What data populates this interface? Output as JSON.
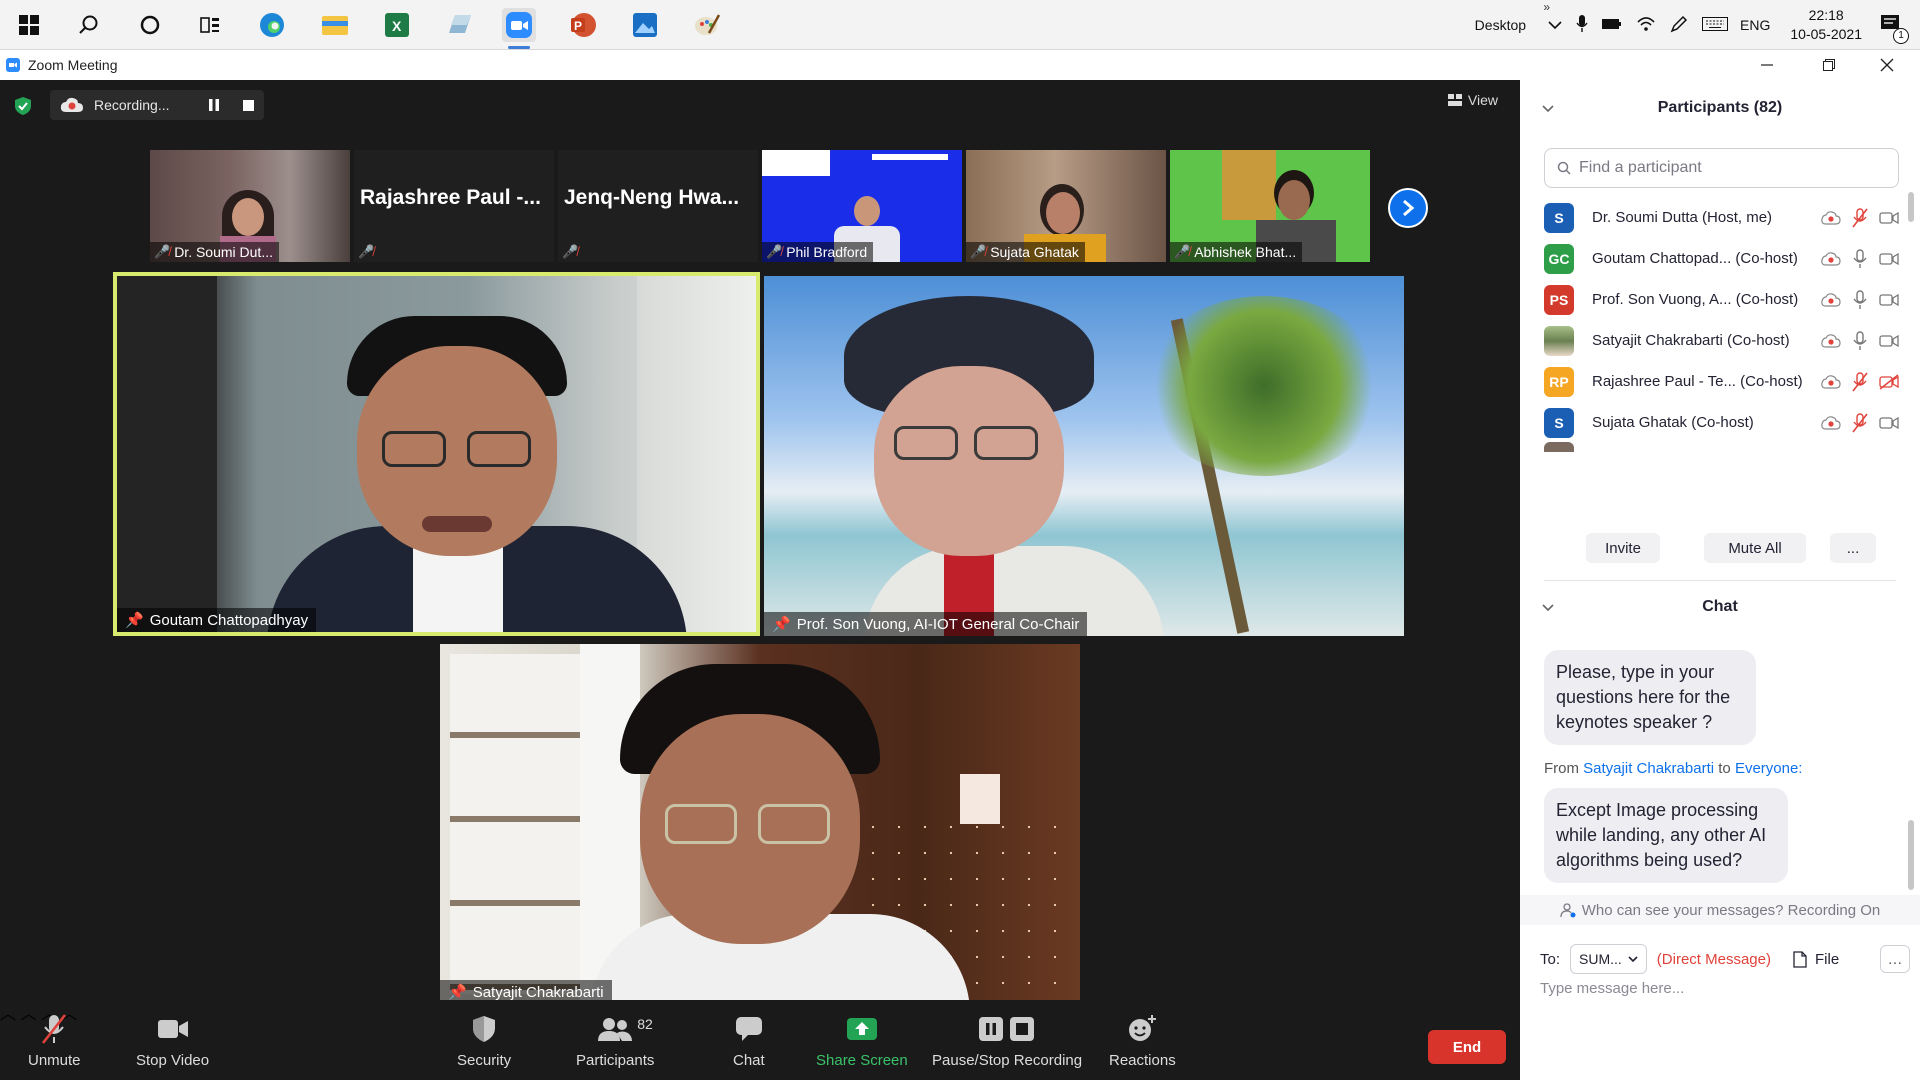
{
  "taskbar": {
    "tray_label": "Desktop",
    "lang": "ENG",
    "time": "22:18",
    "date": "10-05-2021",
    "notif_count": "1",
    "icons": [
      "windows-start-icon",
      "search-icon",
      "cortana-icon",
      "task-view-icon",
      "edge-icon",
      "file-explorer-icon",
      "excel-icon",
      "app-icon",
      "zoom-icon",
      "powerpoint-icon",
      "photos-icon",
      "paint-icon"
    ]
  },
  "window": {
    "title": "Zoom Meeting"
  },
  "meeting": {
    "recording_label": "Recording...",
    "view_label": "View",
    "thumbnails": [
      {
        "name": "Dr. Soumi Dut...",
        "type": "video"
      },
      {
        "name": "Rajashree Paul -...",
        "type": "name"
      },
      {
        "name": "Jenq-Neng Hwa...",
        "type": "name"
      },
      {
        "name": "Phil Bradford",
        "type": "video"
      },
      {
        "name": "Sujata Ghatak",
        "type": "video"
      },
      {
        "name": "Abhishek Bhat...",
        "type": "video"
      }
    ],
    "videos": [
      {
        "name": "Goutam Chattopadhyay"
      },
      {
        "name": "Prof. Son Vuong, AI-IOT General Co-Chair"
      },
      {
        "name": "Satyajit Chakrabarti"
      }
    ]
  },
  "toolbar": {
    "unmute": "Unmute",
    "stop_video": "Stop Video",
    "security": "Security",
    "participants": "Participants",
    "participants_count": "82",
    "chat": "Chat",
    "share_screen": "Share Screen",
    "pause_stop_recording": "Pause/Stop Recording",
    "reactions": "Reactions",
    "end": "End"
  },
  "participants_panel": {
    "title": "Participants (82)",
    "search_placeholder": "Find a participant",
    "list": [
      {
        "initials": "S",
        "color": "#1a5fb4",
        "name": "Dr. Soumi Dutta (Host, me)",
        "mic": "muted",
        "video": "on"
      },
      {
        "initials": "GC",
        "color": "#2e9e48",
        "name": "Goutam Chattopad...  (Co-host)",
        "mic": "on",
        "video": "on"
      },
      {
        "initials": "PS",
        "color": "#d33a2c",
        "name": "Prof. Son Vuong, A...  (Co-host)",
        "mic": "on",
        "video": "on"
      },
      {
        "initials": "",
        "color": "#7a8a5a",
        "name": "Satyajit Chakrabarti  (Co-host)",
        "mic": "on",
        "video": "on"
      },
      {
        "initials": "RP",
        "color": "#f5a623",
        "name": "Rajashree Paul - Te...  (Co-host)",
        "mic": "muted",
        "video": "off"
      },
      {
        "initials": "S",
        "color": "#1a5fb4",
        "name": "Sujata Ghatak  (Co-host)",
        "mic": "muted",
        "video": "on"
      }
    ],
    "invite": "Invite",
    "mute_all": "Mute All",
    "more": "..."
  },
  "chat_panel": {
    "title": "Chat",
    "msg1": "Please, type in your questions here for the keynotes speaker ?",
    "from_prefix": "From",
    "from_name": "Satyajit Chakrabarti",
    "to_word": "to",
    "to_name": "Everyone:",
    "msg2": "Except Image processing while landing, any other AI algorithms being used?",
    "privacy": "Who can see your messages? Recording On",
    "to_label": "To:",
    "to_value": "SUM...",
    "direct_message": "(Direct Message)",
    "file": "File",
    "input_placeholder": "Type message here..."
  }
}
